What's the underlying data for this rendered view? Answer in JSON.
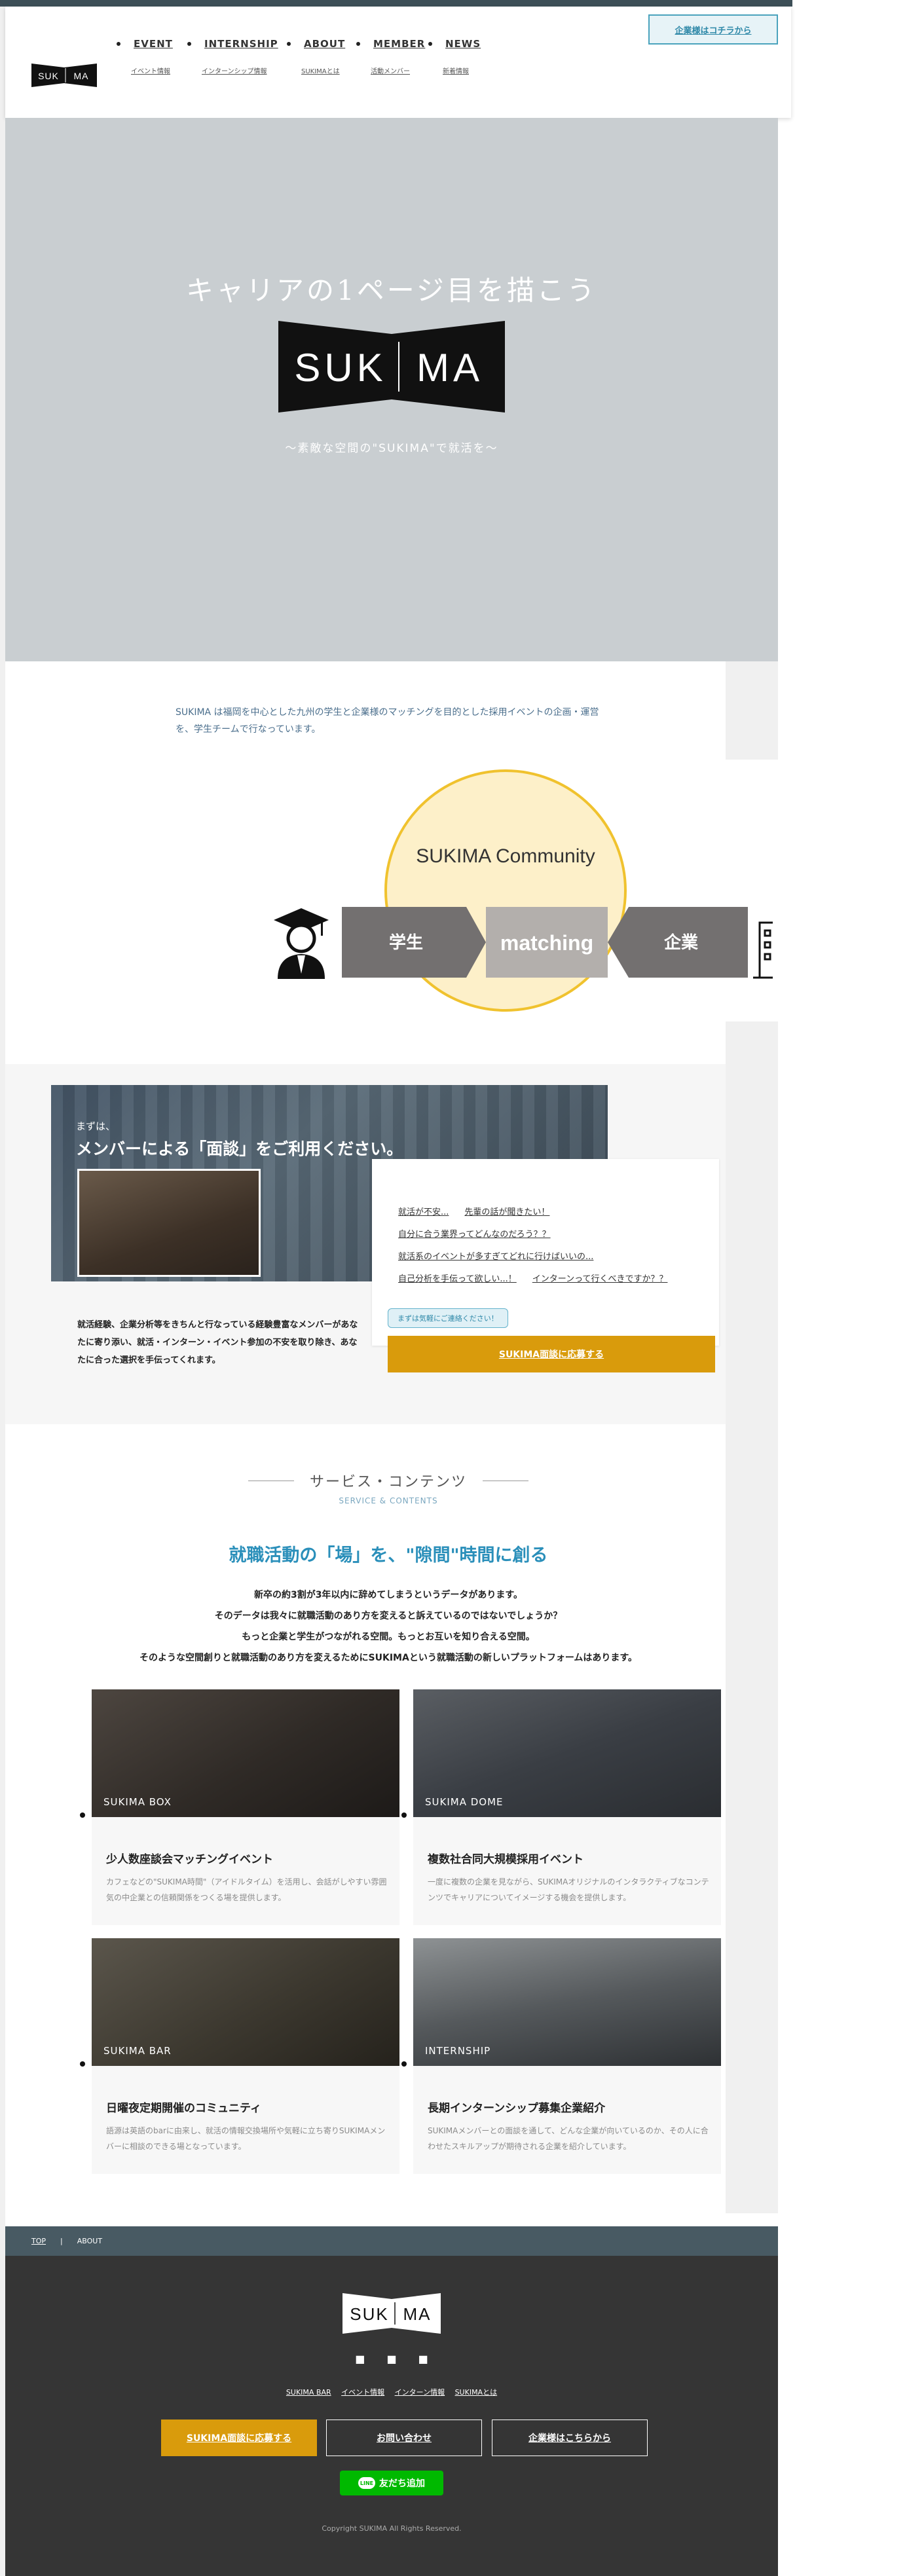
{
  "header": {
    "logo_text": [
      "SUK",
      "MA"
    ],
    "nav": [
      {
        "en": "EVENT",
        "jp": "イベント情報"
      },
      {
        "en": "INTERNSHIP",
        "jp": "インターンシップ情報"
      },
      {
        "en": "ABOUT",
        "jp": "SUKIMAとは"
      },
      {
        "en": "MEMBER",
        "jp": "活動メンバー"
      },
      {
        "en": "NEWS",
        "jp": "新着情報"
      }
    ],
    "corp_button": "企業様はコチラから"
  },
  "hero": {
    "catch": "キャリアの1ページ目を描こう",
    "logo_text": [
      "SUK",
      "MA"
    ],
    "sub": "〜素敵な空間の\"SUKIMA\"で就活を〜"
  },
  "intro": {
    "text": "SUKIMA は福岡を中心とした九州の学生と企業様のマッチングを目的とした採用イベントの企画・運営を、学生チームで行なっています。",
    "community_label": "SUKIMA Community",
    "student_label": "学生",
    "matching_label": "matching",
    "company_label": "企業"
  },
  "interview": {
    "pre": "まずは、",
    "title": "メンバーによる「面談」をご利用ください。",
    "faq": [
      [
        "就活が不安...",
        "先輩の話が聞きたい！"
      ],
      [
        "自分に合う業界ってどんなのだろう？？"
      ],
      [
        "就活系のイベントが多すぎてどれに行けばいいの..."
      ],
      [
        "自己分析を手伝って欲しい...！",
        "インターンって行くべきですか？？"
      ]
    ],
    "bubble": "まずは気軽にご連絡ください！",
    "apply_button": "SUKIMA面談に応募する",
    "desc": "就活経験、企業分析等をきちんと行なっている経験豊富なメンバーがあなたに寄り添い、就活・インターン・イベント参加の不安を取り除き、あなたに合った選択を手伝ってくれます。"
  },
  "service": {
    "heading_jp": "サービス・コンテンツ",
    "heading_en": "SERVICE & CONTENTS",
    "main": "就職活動の「場」を、\"隙間\"時間に創る",
    "lead": [
      "新卒の約3割が3年以内に辞めてしまうというデータがあります。",
      "そのデータは我々に就職活動のあり方を変えると訴えているのではないでしょうか？",
      "もっと企業と学生がつながれる空間。もっとお互いを知り合える空間。",
      "そのような空間創りと就職活動のあり方を変えるためにSUKIMAという就職活動の新しいプラットフォームはあります。"
    ],
    "cards": [
      {
        "tag": "SUKIMA BOX",
        "title": "少人数座談会マッチングイベント",
        "desc": "カフェなどの\"SUKIMA時間\"（アイドルタイム）を活用し、会話がしやすい雰囲気の中企業との信頼関係をつくる場を提供します。"
      },
      {
        "tag": "SUKIMA DOME",
        "title": "複数社合同大規模採用イベント",
        "desc": "一度に複数の企業を見ながら、SUKIMAオリジナルのインタラクティブなコンテンツでキャリアについてイメージする機会を提供します。"
      },
      {
        "tag": "SUKIMA BAR",
        "title": "日曜夜定期開催のコミュニティ",
        "desc": "語源は英語のbarに由来し、就活の情報交換場所や気軽に立ち寄りSUKIMAメンバーに相談のできる場となっています。"
      },
      {
        "tag": "INTERNSHIP",
        "title": "長期インターンシップ募集企業紹介",
        "desc": "SUKIMAメンバーとの面談を通して、どんな企業が向いているのか、その人に合わせたスキルアップが期待される企業を紹介しています。"
      }
    ]
  },
  "breadcrumb": {
    "top": "TOP",
    "current": "ABOUT"
  },
  "footer": {
    "logo_text": [
      "SUK",
      "MA"
    ],
    "icons": [
      "facebook-icon",
      "twitter-icon",
      "instagram-icon"
    ],
    "links": [
      "SUKIMA BAR",
      "イベント情報",
      "インターン情報",
      "SUKIMAとは"
    ],
    "buttons": [
      "SUKIMA面談に応募する",
      "お問い合わせ",
      "企業様はこちらから"
    ],
    "line_button": "友だち追加",
    "line_icon_text": "LINE",
    "copyright": "Copyright SUKIMA All Rights Reserved."
  },
  "colors": {
    "accent": "#d99b0c",
    "blue": "#2a8fba",
    "footer": "#353535",
    "hero": "#c9ced1"
  }
}
